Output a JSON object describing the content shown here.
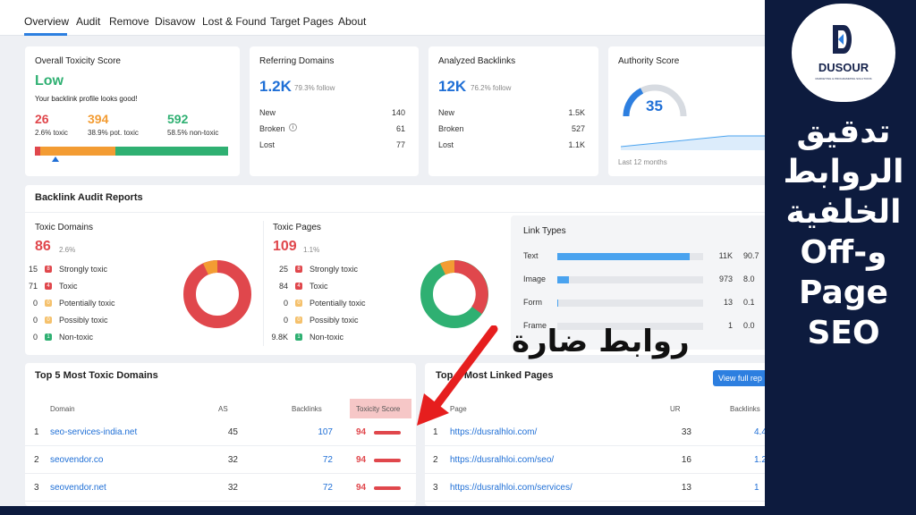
{
  "tabs": [
    "Overview",
    "Audit",
    "Remove",
    "Disavow",
    "Lost & Found",
    "Target Pages",
    "About"
  ],
  "toxicity": {
    "title": "Overall Toxicity Score",
    "level": "Low",
    "message": "Your backlink profile looks good!",
    "stats": [
      {
        "value": "26",
        "label": "2.6% toxic"
      },
      {
        "value": "394",
        "label": "38.9% pot. toxic"
      },
      {
        "value": "592",
        "label": "58.5% non-toxic"
      }
    ],
    "shares": [
      0.026,
      0.389,
      0.585
    ]
  },
  "referring": {
    "title": "Referring Domains",
    "value": "1.2K",
    "follow": "79.3% follow",
    "rows": [
      {
        "label": "New",
        "value": "140"
      },
      {
        "label": "Broken",
        "value": "61"
      },
      {
        "label": "Lost",
        "value": "77"
      }
    ]
  },
  "analyzed": {
    "title": "Analyzed Backlinks",
    "value": "12K",
    "follow": "76.2% follow",
    "rows": [
      {
        "label": "New",
        "value": "1.5K"
      },
      {
        "label": "Broken",
        "value": "527"
      },
      {
        "label": "Lost",
        "value": "1.1K"
      }
    ]
  },
  "authority": {
    "title": "Authority Score",
    "value": "35",
    "caption": "Last 12 months",
    "gauge_fraction": 0.35
  },
  "reports_title": "Backlink Audit Reports",
  "toxic_domains": {
    "title": "Toxic Domains",
    "value": "86",
    "pct": "2.6%",
    "rows": [
      {
        "count": "15",
        "badge": "8",
        "label": "Strongly toxic"
      },
      {
        "count": "71",
        "badge": "4",
        "label": "Toxic"
      },
      {
        "count": "0",
        "badge": "0",
        "label": "Potentially toxic"
      },
      {
        "count": "0",
        "badge": "0",
        "label": "Possibly toxic"
      },
      {
        "count": "0",
        "badge": "1",
        "label": "Non-toxic"
      }
    ]
  },
  "toxic_pages": {
    "title": "Toxic Pages",
    "value": "109",
    "pct": "1.1%",
    "rows": [
      {
        "count": "25",
        "badge": "8",
        "label": "Strongly toxic"
      },
      {
        "count": "84",
        "badge": "4",
        "label": "Toxic"
      },
      {
        "count": "0",
        "badge": "0",
        "label": "Potentially toxic"
      },
      {
        "count": "0",
        "badge": "0",
        "label": "Possibly toxic"
      },
      {
        "count": "9.8K",
        "badge": "1",
        "label": "Non-toxic"
      }
    ]
  },
  "link_types": {
    "title": "Link Types",
    "rows": [
      {
        "label": "Text",
        "value": "11K",
        "pct": "90.7",
        "fraction": 0.907
      },
      {
        "label": "Image",
        "value": "973",
        "pct": "8.0",
        "fraction": 0.08
      },
      {
        "label": "Form",
        "value": "13",
        "pct": "0.1",
        "fraction": 0.001
      },
      {
        "label": "Frame",
        "value": "1",
        "pct": "0.0",
        "fraction": 0.0
      }
    ]
  },
  "top_domains": {
    "title": "Top 5 Most Toxic Domains",
    "headers": [
      "Domain",
      "AS",
      "Backlinks",
      "Toxicity Score"
    ],
    "rows": [
      {
        "n": "1",
        "domain": "seo-services-india.net",
        "as": "45",
        "backlinks": "107",
        "score": "94"
      },
      {
        "n": "2",
        "domain": "seovendor.co",
        "as": "32",
        "backlinks": "72",
        "score": "94"
      },
      {
        "n": "3",
        "domain": "seovendor.net",
        "as": "32",
        "backlinks": "72",
        "score": "94"
      }
    ]
  },
  "linked_pages": {
    "title": "Top ~ Most Linked Pages",
    "button": "View full rep",
    "headers": [
      "Page",
      "UR",
      "Backlinks"
    ],
    "rows": [
      {
        "n": "1",
        "page": "https://dusralhloi.com/",
        "ur": "33",
        "backlinks": "4.4"
      },
      {
        "n": "2",
        "page": "https://dusralhloi.com/seo/",
        "ur": "16",
        "backlinks": "1.2"
      },
      {
        "n": "3",
        "page": "https://dusralhloi.com/services/",
        "ur": "13",
        "backlinks": "1"
      }
    ]
  },
  "annotation": "روابط ضارة",
  "brand": {
    "name": "DUSOUR",
    "tagline": "MARKETING & PROGRAMMING SOLUTIONS"
  },
  "arabic_title": [
    "تدقيق",
    "الروابط",
    "الخلفية",
    "Off-و",
    "Page",
    "SEO"
  ],
  "colors": {
    "accent": "#2d7fe0",
    "red": "#e0474c",
    "orange": "#f39c33",
    "green": "#2fb072",
    "navy": "#0d1b3e"
  }
}
